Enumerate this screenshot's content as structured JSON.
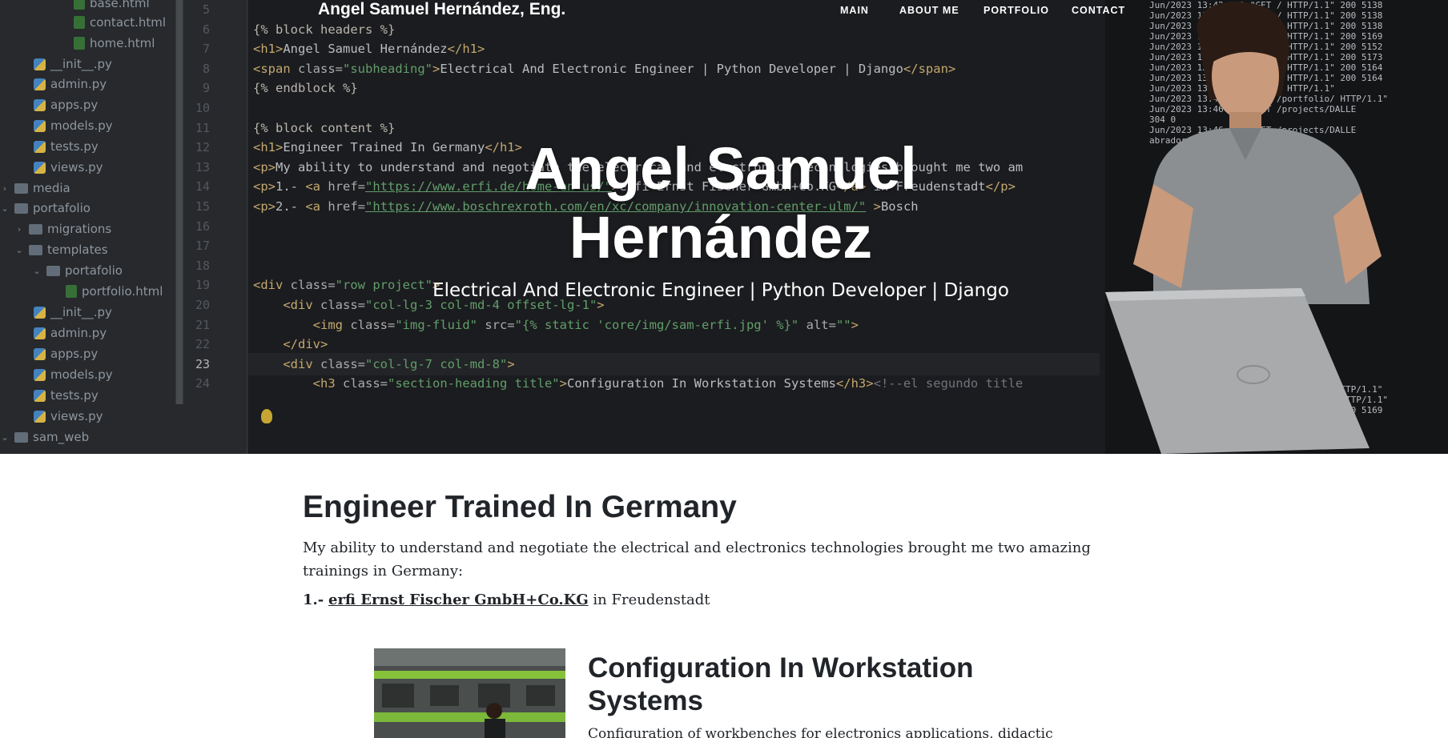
{
  "file_tree": [
    {
      "label": "base.html",
      "icon": "html-file-icon",
      "indent": 0
    },
    {
      "label": "contact.html",
      "icon": "html-file-icon",
      "indent": 0
    },
    {
      "label": "home.html",
      "icon": "html-file-icon",
      "indent": 0
    },
    {
      "label": "__init__.py",
      "icon": "python-file-icon",
      "indent": 0
    },
    {
      "label": "admin.py",
      "icon": "python-file-icon",
      "indent": 0
    },
    {
      "label": "apps.py",
      "icon": "python-file-icon",
      "indent": 0
    },
    {
      "label": "models.py",
      "icon": "python-file-icon",
      "indent": 0
    },
    {
      "label": "tests.py",
      "icon": "python-file-icon",
      "indent": 0
    },
    {
      "label": "views.py",
      "icon": "python-file-icon",
      "indent": 0
    },
    {
      "label": "media",
      "icon": "folder-icon",
      "indent": 0
    },
    {
      "label": "portafolio",
      "icon": "folder-icon",
      "indent": 0
    },
    {
      "label": "migrations",
      "icon": "folder-icon",
      "indent": 0
    },
    {
      "label": "templates",
      "icon": "folder-icon",
      "indent": 0
    },
    {
      "label": "portafolio",
      "icon": "folder-icon",
      "indent": 0
    },
    {
      "label": "portfolio.html",
      "icon": "html-file-icon",
      "indent": 0
    },
    {
      "label": "__init__.py",
      "icon": "python-file-icon",
      "indent": 0
    },
    {
      "label": "admin.py",
      "icon": "python-file-icon",
      "indent": 0
    },
    {
      "label": "apps.py",
      "icon": "python-file-icon",
      "indent": 0
    },
    {
      "label": "models.py",
      "icon": "python-file-icon",
      "indent": 0
    },
    {
      "label": "tests.py",
      "icon": "python-file-icon",
      "indent": 0
    },
    {
      "label": "views.py",
      "icon": "python-file-icon",
      "indent": 0
    },
    {
      "label": "sam_web",
      "icon": "folder-icon",
      "indent": 0
    }
  ],
  "code_lines": [
    {
      "num": "5",
      "text": ""
    },
    {
      "num": "6",
      "text": "{% block headers %}"
    },
    {
      "num": "7",
      "text": "<h1>Angel Samuel Hernández</h1>"
    },
    {
      "num": "8",
      "text": "<span class=\"subheading\">Electrical And Electronic Engineer | Python Developer | Django</span>"
    },
    {
      "num": "9",
      "text": "{% endblock %}"
    },
    {
      "num": "10",
      "text": ""
    },
    {
      "num": "11",
      "text": "{% block content %}"
    },
    {
      "num": "12",
      "text": "<h1>Engineer Trained In Germany</h1>"
    },
    {
      "num": "13",
      "text": "<p>My ability to understand and negotiate the electrical and electronics technologies brought me two am"
    },
    {
      "num": "14",
      "text": "<p>1.- <a href=\"https://www.erfi.de/home-en-us/\">erfi Ernst Fischer GmbH+Co.KG</a> in Freudenstadt</p>"
    },
    {
      "num": "15",
      "text": "<p>2.- <a href=\"https://www.boschrexroth.com/en/xc/company/innovation-center-ulm/\" >Bosch"
    },
    {
      "num": "16",
      "text": ""
    },
    {
      "num": "17",
      "text": ""
    },
    {
      "num": "18",
      "text": ""
    },
    {
      "num": "19",
      "text": "<div class=\"row project\">"
    },
    {
      "num": "20",
      "text": "    <div class=\"col-lg-3 col-md-4 offset-lg-1\">"
    },
    {
      "num": "21",
      "text": "        <img class=\"img-fluid\" src=\"{% static 'core/img/sam-erfi.jpg' %}\" alt=\"\">"
    },
    {
      "num": "22",
      "text": "    </div>"
    },
    {
      "num": "23",
      "text": "    <div class=\"col-lg-7 col-md-8\">"
    },
    {
      "num": "24",
      "text": "        <h3 class=\"section-heading title\">Configuration In Workstation Systems</h3><!--el segundo title"
    }
  ],
  "terminal_lines": [
    "Jun/2023 13:42:04] \"GET / HTTP/1.1\" 200 5138",
    "Jun/2023 13:42:04] \"GET / HTTP/1.1\" 200 5138",
    "Jun/2023 13:42:04] \"GET / HTTP/1.1\" 200 5138",
    "Jun/2023 13:42:47] \"GET / HTTP/1.1\" 200 5169",
    "Jun/2023 13:43:15] \"GET / HTTP/1.1\" 200 5152",
    "Jun/2023 13:44:15] \"GET / HTTP/1.1\" 200 5173",
    "Jun/2023 13:46:10] \"GET / HTTP/1.1\" 200 5164",
    "Jun/2023 13:46:13] \"GET / HTTP/1.1\" 200 5164",
    "Jun/2023 13:46:13] \"GET / HTTP/1.1\"",
    "Jun/2023 13:46:16] \"GET /portfolio/ HTTP/1.1\"",
    "Jun/2023 13:46:16] \"GET /projects/DALLE",
    "304 0",
    "Jun/2023 13:46:16] \"GET /projects/DALLE",
    "abrador.png HTTP/1.1\"",
    "Jun/2023 13:52:48] \"GET /about_me/ HTTP/1.1\"",
    "Jun/2023 13:52:51] \"GET /portfolio/ HTTP/1.1\"",
    "Jun/2023 13:52:55] \"GET / HTTP/1.1\" 200 5169"
  ],
  "nav": {
    "brand": "Angel Samuel Hernández, Eng.",
    "links": [
      "MAIN",
      "ABOUT ME",
      "PORTFOLIO",
      "CONTACT"
    ]
  },
  "hero": {
    "title_line1": "Angel Samuel",
    "title_line2": "Hernández",
    "subtitle": "Electrical And Electronic Engineer | Python Developer | Django"
  },
  "content": {
    "heading": "Engineer Trained In Germany",
    "paragraph": "My ability to understand and negotiate the electrical and electronics technologies brought me two amazing trainings in Germany:",
    "item_prefix": "1.-",
    "item_link": "erfi Ernst Fischer GmbH+Co.KG",
    "item_suffix": " in Freudenstadt"
  },
  "project": {
    "title": "Configuration In Workstation Systems",
    "description": "Configuration of workbenches for electronics applications, didactic"
  },
  "colors": {
    "hero_bg": "#1e1f22",
    "text_dark": "#212529",
    "accent_tag": "#d5b778",
    "accent_string": "#6aab73"
  }
}
